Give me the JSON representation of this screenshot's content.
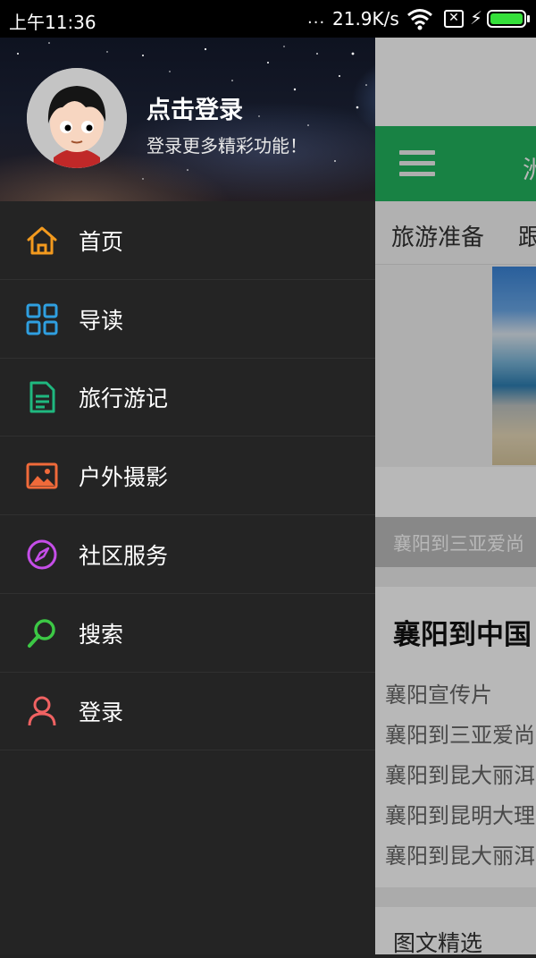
{
  "status_bar": {
    "time": "上午11:36",
    "signal_dots": "...",
    "net_speed": "21.9K/s",
    "battery_level_pct": 100,
    "icons": [
      "wifi-icon",
      "sim-x-icon",
      "charging-bolt-icon",
      "battery-icon"
    ]
  },
  "drawer": {
    "header": {
      "title": "点击登录",
      "subtitle": "登录更多精彩功能！"
    },
    "items": [
      {
        "label": "首页",
        "icon": "home-icon",
        "color": "#f39a1e"
      },
      {
        "label": "导读",
        "icon": "grid-icon",
        "color": "#2f9fe0"
      },
      {
        "label": "旅行游记",
        "icon": "document-icon",
        "color": "#1fb87f"
      },
      {
        "label": "户外摄影",
        "icon": "image-icon",
        "color": "#f06a3a"
      },
      {
        "label": "社区服务",
        "icon": "compass-icon",
        "color": "#c54ee8"
      },
      {
        "label": "搜索",
        "icon": "search-icon",
        "color": "#3cc845"
      },
      {
        "label": "登录",
        "icon": "user-icon",
        "color": "#f06262"
      }
    ]
  },
  "background_app": {
    "appbar_title_partial": "洲",
    "tabs": [
      "旅游准备",
      "跟"
    ],
    "banner_caption": "襄阳到三亚爱尚",
    "article_title": "襄阳到中国",
    "links": [
      "襄阳宣传片",
      "襄阳到三亚爱尚",
      "襄阳到昆大丽洱",
      "襄阳到昆明大理",
      "襄阳到昆大丽洱"
    ],
    "section_title": "图文精选",
    "accent_color": "#22b45f"
  }
}
